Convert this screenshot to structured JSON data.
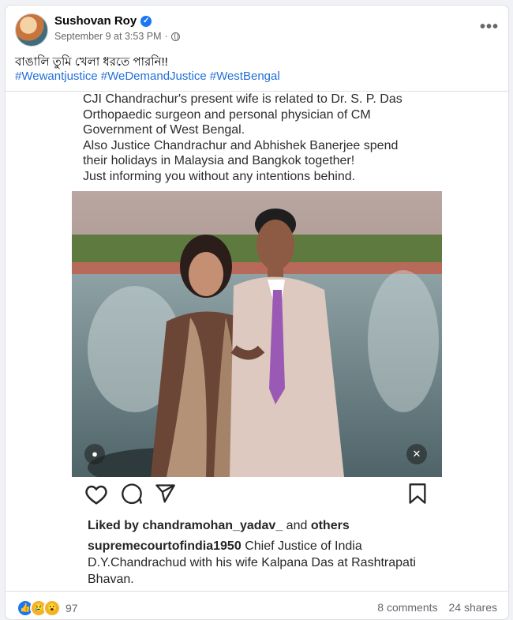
{
  "post": {
    "author": "Sushovan Roy",
    "timestamp": "September 9 at 3:53 PM",
    "separator": "·",
    "more_label": "•••",
    "text": "বাঙালি তুমি খেলা ধরতে পারনি!!",
    "hashtags": [
      "#Wewantjustice",
      "#WeDemandJustice",
      "#WestBengal"
    ]
  },
  "media": {
    "quote": "CJI Chandrachur's present wife is related to Dr. S. P. Das\nOrthopaedic surgeon and personal physician of CM\nGovernment of West Bengal.\nAlso Justice Chandrachur and Abhishek Banerjee spend\ntheir holidays in Malaysia and Bangkok together!\nJust informing you without any intentions behind.",
    "liked_prefix": "Liked by",
    "liked_user": "chandramohan_yadav_",
    "liked_and": "and",
    "liked_others": "others",
    "caption_user": "supremecourtofindia1950",
    "caption_text": "Chief Justice of India D.Y.Chandrachud with his wife Kalpana Das at Rashtrapati Bhavan."
  },
  "footer": {
    "reaction_count": "97",
    "comments": "8 comments",
    "shares": "24 shares"
  },
  "colors": {
    "link": "#216fdb",
    "facebook_blue": "#1877f2"
  }
}
